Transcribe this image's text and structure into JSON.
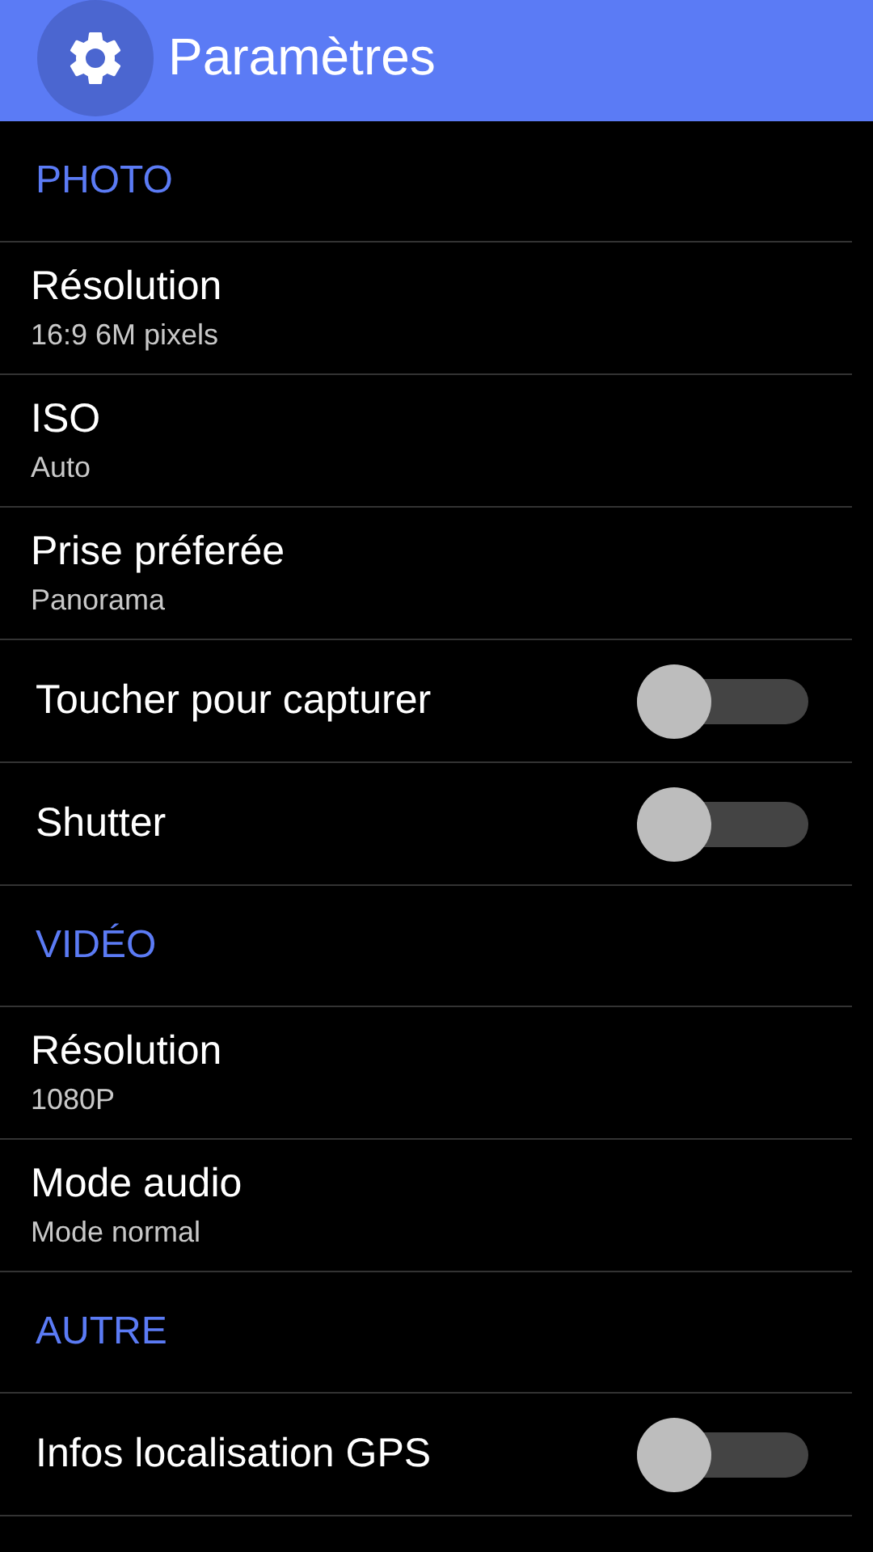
{
  "app_bar": {
    "title": "Paramètres"
  },
  "sections": [
    {
      "title": "PHOTO",
      "items": [
        {
          "kind": "detail",
          "title": "Résolution",
          "summary": "16:9 6M pixels"
        },
        {
          "kind": "detail",
          "title": "ISO",
          "summary": "Auto"
        },
        {
          "kind": "detail",
          "title": "Prise préferée",
          "summary": "Panorama"
        },
        {
          "kind": "switch",
          "title": "Toucher pour capturer",
          "on": false
        },
        {
          "kind": "switch",
          "title": "Shutter",
          "on": false
        }
      ]
    },
    {
      "title": "VIDÉO",
      "items": [
        {
          "kind": "detail",
          "title": "Résolution",
          "summary": "1080P"
        },
        {
          "kind": "detail",
          "title": "Mode audio",
          "summary": "Mode normal"
        }
      ]
    },
    {
      "title": "AUTRE",
      "items": [
        {
          "kind": "switch",
          "title": "Infos localisation GPS",
          "on": false
        }
      ]
    }
  ]
}
